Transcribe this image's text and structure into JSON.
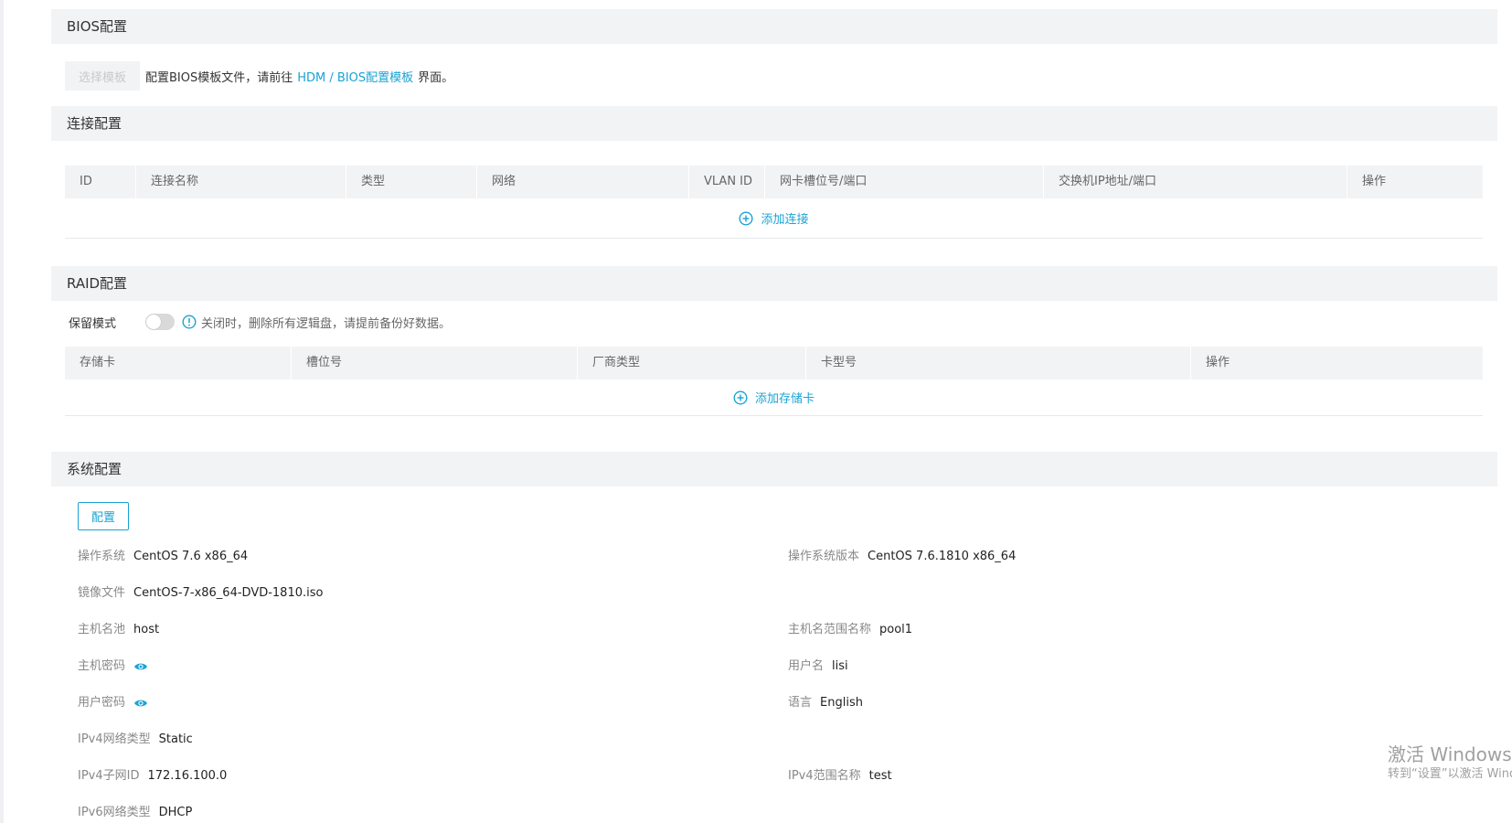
{
  "bios": {
    "title": "BIOS配置",
    "select_template_button": "选择模板",
    "text_before": "配置BIOS模板文件，请前往",
    "link": "HDM / BIOS配置模板",
    "text_after": "界面。"
  },
  "connection": {
    "title": "连接配置",
    "columns": [
      "ID",
      "连接名称",
      "类型",
      "网络",
      "VLAN ID",
      "网卡槽位号/端口",
      "交换机IP地址/端口",
      "操作"
    ],
    "add_label": "添加连接"
  },
  "raid": {
    "title": "RAID配置",
    "retain_label": "保留模式",
    "retain_on": false,
    "retain_hint": "关闭时，删除所有逻辑盘，请提前备份好数据。",
    "columns": [
      "存储卡",
      "槽位号",
      "厂商类型",
      "卡型号",
      "操作"
    ],
    "add_label": "添加存储卡"
  },
  "system": {
    "title": "系统配置",
    "config_button": "配置",
    "fields": {
      "os": {
        "label": "操作系统",
        "value": "CentOS 7.6 x86_64"
      },
      "os_version": {
        "label": "操作系统版本",
        "value": "CentOS 7.6.1810 x86_64"
      },
      "image": {
        "label": "镜像文件",
        "value": "CentOS-7-x86_64-DVD-1810.iso"
      },
      "host_pool": {
        "label": "主机名池",
        "value": "host"
      },
      "host_range": {
        "label": "主机名范围名称",
        "value": "pool1"
      },
      "host_password": {
        "label": "主机密码"
      },
      "username": {
        "label": "用户名",
        "value": "lisi"
      },
      "user_password": {
        "label": "用户密码"
      },
      "language": {
        "label": "语言",
        "value": "English"
      },
      "ipv4_type": {
        "label": "IPv4网络类型",
        "value": "Static"
      },
      "ipv4_subnet": {
        "label": "IPv4子网ID",
        "value": "172.16.100.0"
      },
      "ipv4_range": {
        "label": "IPv4范围名称",
        "value": "test"
      },
      "ipv6_type": {
        "label": "IPv6网络类型",
        "value": "DHCP"
      }
    }
  },
  "watermark": {
    "line1": "激活 Windows",
    "line2": "转到“设置”以激活 Windows。"
  },
  "colors": {
    "accent": "#1aa3d4",
    "header_bg": "#f2f3f5"
  }
}
